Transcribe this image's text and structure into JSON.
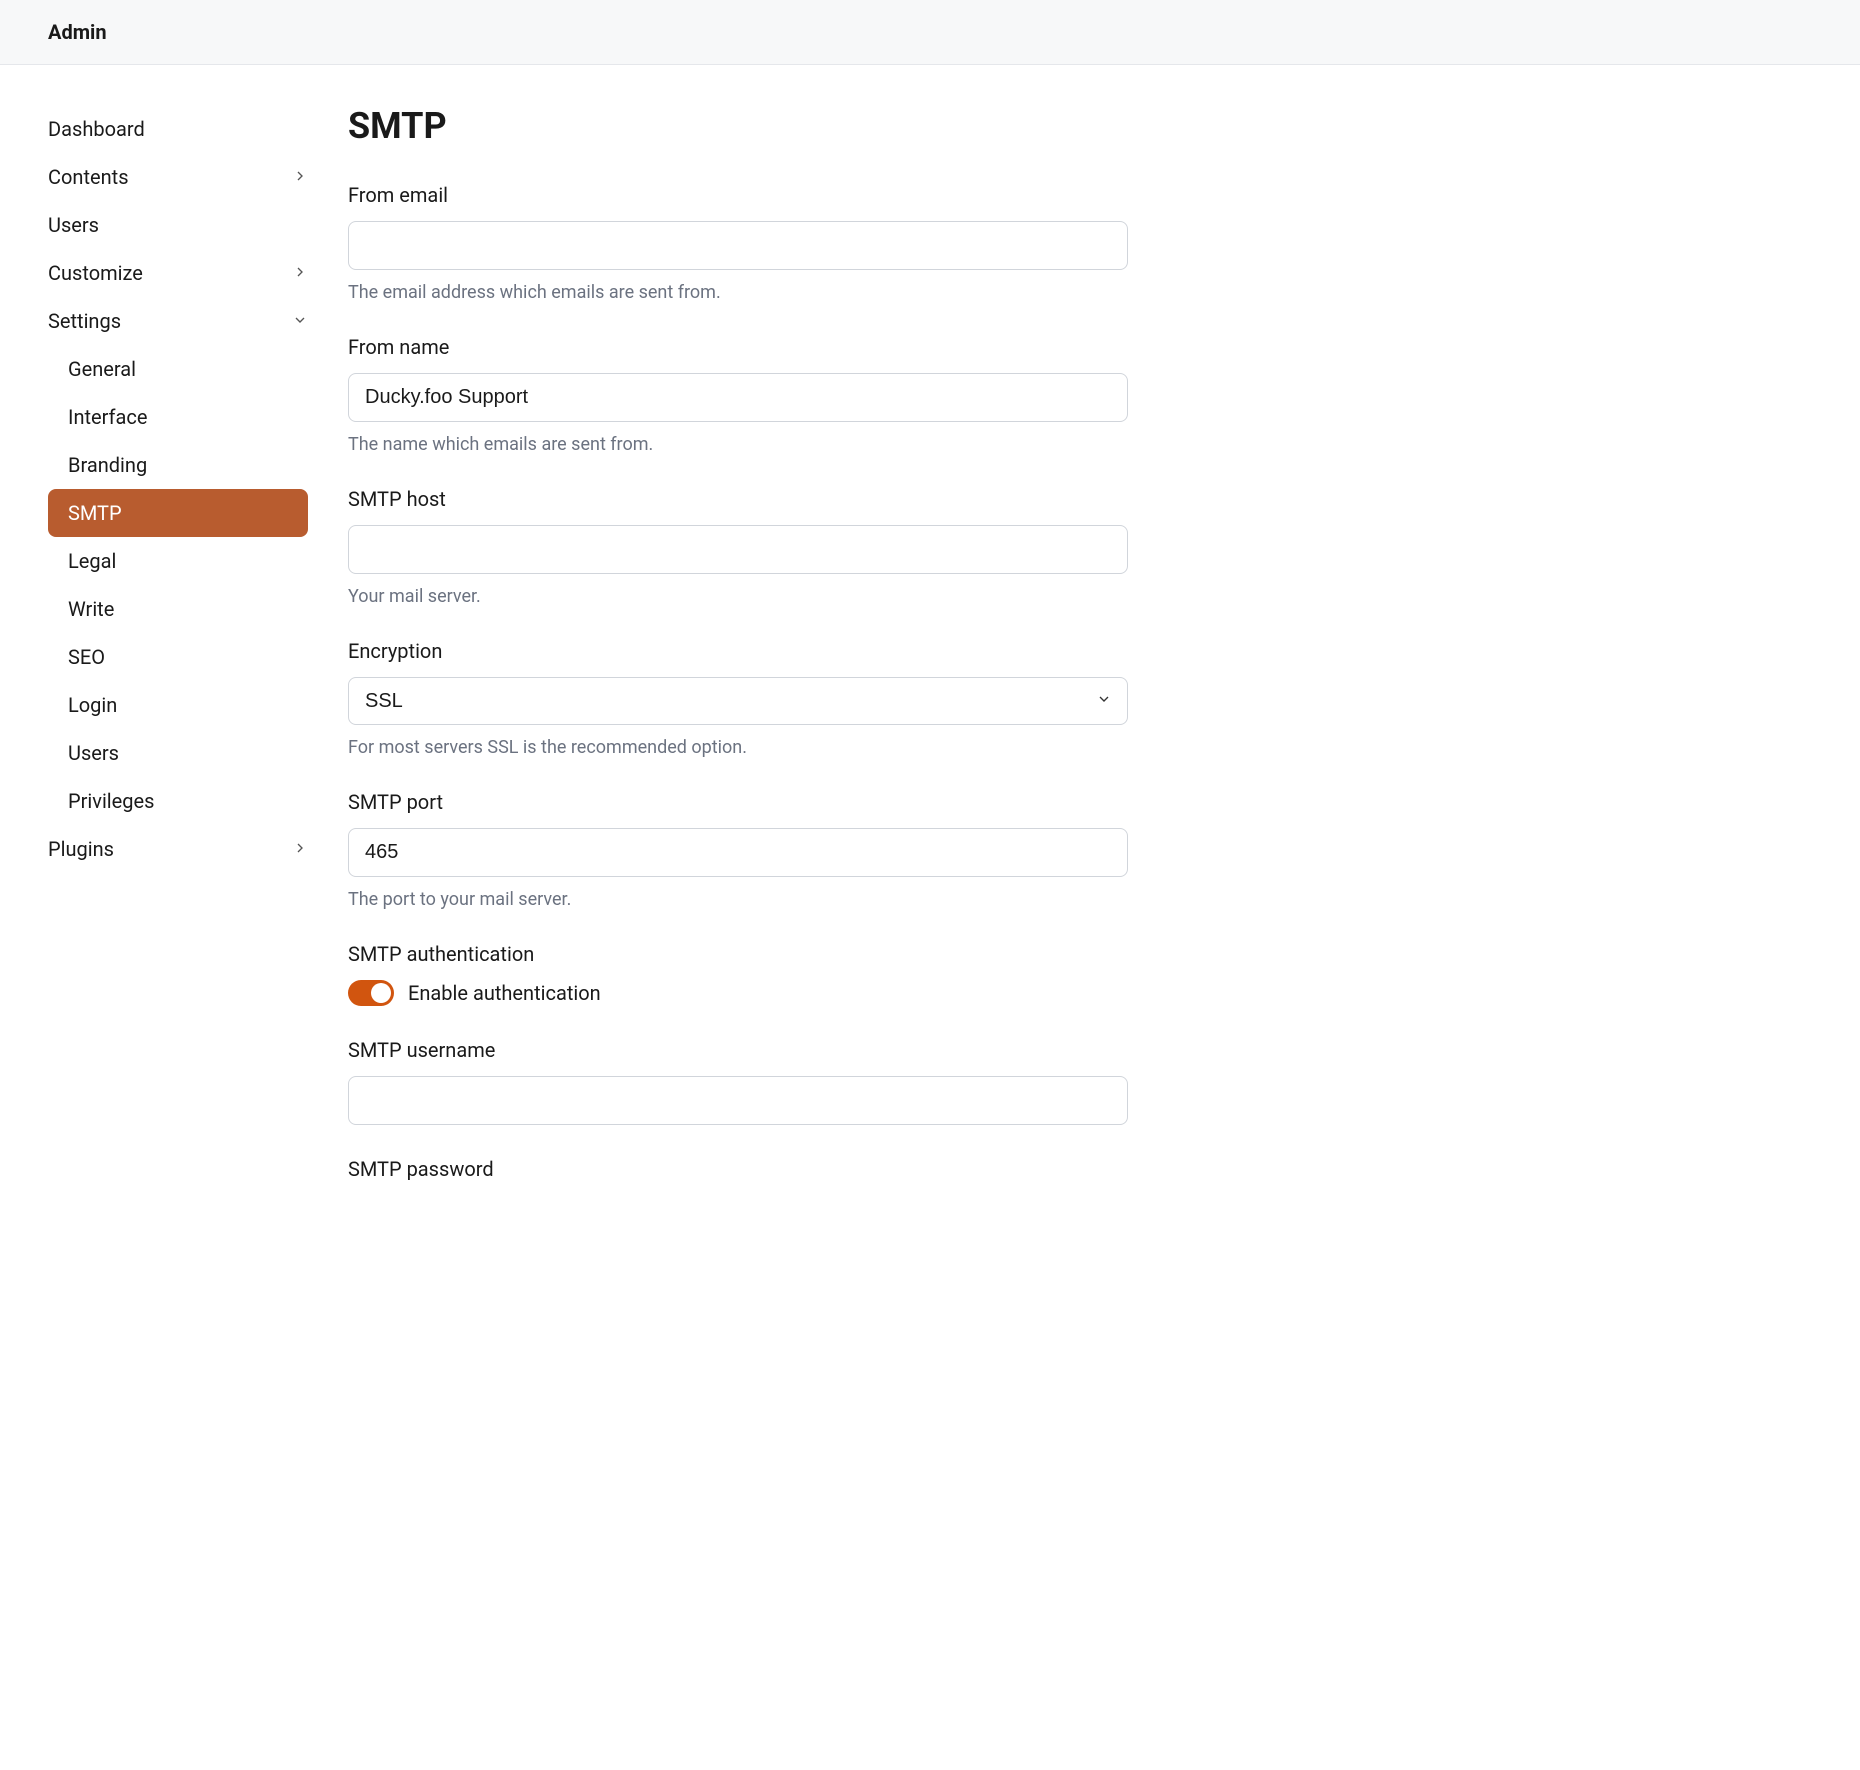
{
  "header": {
    "title": "Admin"
  },
  "sidebar": {
    "items": [
      {
        "label": "Dashboard",
        "expandable": false
      },
      {
        "label": "Contents",
        "expandable": true
      },
      {
        "label": "Users",
        "expandable": false
      },
      {
        "label": "Customize",
        "expandable": true
      },
      {
        "label": "Settings",
        "expandable": true,
        "open": true
      },
      {
        "label": "Plugins",
        "expandable": true
      }
    ],
    "settings_sub": [
      {
        "label": "General"
      },
      {
        "label": "Interface"
      },
      {
        "label": "Branding"
      },
      {
        "label": "SMTP",
        "active": true
      },
      {
        "label": "Legal"
      },
      {
        "label": "Write"
      },
      {
        "label": "SEO"
      },
      {
        "label": "Login"
      },
      {
        "label": "Users"
      },
      {
        "label": "Privileges"
      }
    ]
  },
  "page": {
    "title": "SMTP"
  },
  "fields": {
    "from_email": {
      "label": "From email",
      "value": "",
      "help": "The email address which emails are sent from."
    },
    "from_name": {
      "label": "From name",
      "value": "Ducky.foo Support",
      "help": "The name which emails are sent from."
    },
    "smtp_host": {
      "label": "SMTP host",
      "value": "",
      "help": "Your mail server."
    },
    "encryption": {
      "label": "Encryption",
      "value": "SSL",
      "help": "For most servers SSL is the recommended option."
    },
    "smtp_port": {
      "label": "SMTP port",
      "value": "465",
      "help": "The port to your mail server."
    },
    "smtp_auth": {
      "label": "SMTP authentication",
      "toggle_label": "Enable authentication",
      "enabled": true
    },
    "smtp_username": {
      "label": "SMTP username",
      "value": ""
    },
    "smtp_password": {
      "label": "SMTP password",
      "value": ""
    }
  }
}
